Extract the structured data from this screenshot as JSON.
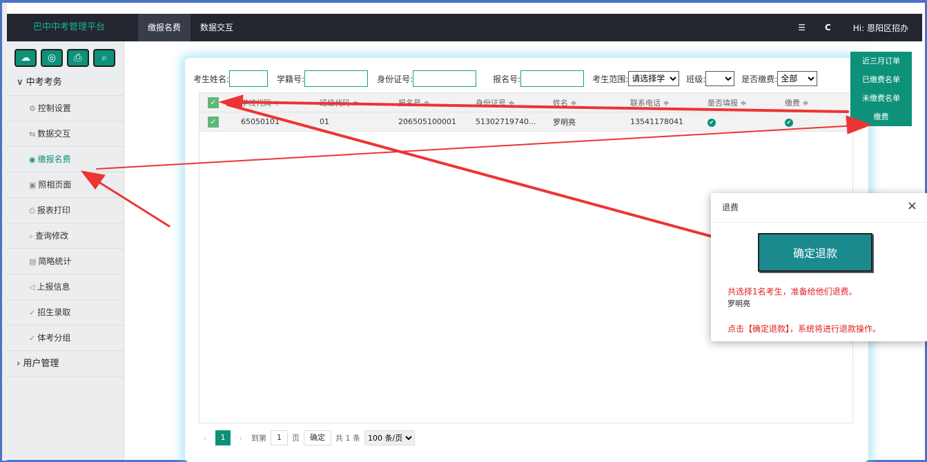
{
  "brand": "巴中中考管理平台",
  "topnav": [
    "缴报名费",
    "数据交互"
  ],
  "topright": {
    "menu_icon": "☰",
    "refresh_icon": "C",
    "greeting": "Hi: 恩阳区招办"
  },
  "sidebar": {
    "group1": "中考考务",
    "items": [
      {
        "icon": "⚙",
        "label": "控制设置"
      },
      {
        "icon": "⇆",
        "label": "数据交互"
      },
      {
        "icon": "◉",
        "label": "缴报名费"
      },
      {
        "icon": "▣",
        "label": "照相页面"
      },
      {
        "icon": "⎙",
        "label": "报表打印"
      },
      {
        "icon": "⌕",
        "label": "查询修改"
      },
      {
        "icon": "▤",
        "label": "简略统计"
      },
      {
        "icon": "◁",
        "label": "上报信息"
      },
      {
        "icon": "✓",
        "label": "招生录取"
      },
      {
        "icon": "✓",
        "label": "体考分组"
      }
    ],
    "group2": "用户管理"
  },
  "filters": {
    "name_label": "考生姓名:",
    "xuejihao_label": "学籍号:",
    "idcard_label": "身份证号:",
    "baomhao_label": "报名号:",
    "range_label": "考生范围:",
    "range_value": "请选择学",
    "class_label": "班级:",
    "class_value": "",
    "paid_label": "是否缴费:",
    "paid_value": "全部"
  },
  "table": {
    "headers": [
      "学校代码 ≑",
      "班级代码 ≑",
      "报名号 ≑",
      "身份证号 ≑",
      "姓名 ≑",
      "联系电话 ≑",
      "是否填报 ≑",
      "缴费 ≑"
    ],
    "rows": [
      [
        "65050101",
        "01",
        "206505100001",
        "51302719740...",
        "罗明亮",
        "13541178041",
        "✔",
        "✔"
      ]
    ]
  },
  "pager": {
    "prev": "‹",
    "page": "1",
    "next": "›",
    "goto": "到第",
    "page_input": "1",
    "page_unit": "页",
    "confirm": "确定",
    "total": "共 1 条",
    "per_page": "100 条/页"
  },
  "right_buttons": [
    "近三月订单",
    "已缴费名单",
    "未缴费名单",
    "缴费"
  ],
  "dialog": {
    "title": "退费",
    "close": "×",
    "button": "确定退款",
    "msg1": "共选择1名考生，准备给他们退费。",
    "msg2": "罗明亮",
    "msg3": "点击【确定退款】，系统将进行退款操作。"
  }
}
